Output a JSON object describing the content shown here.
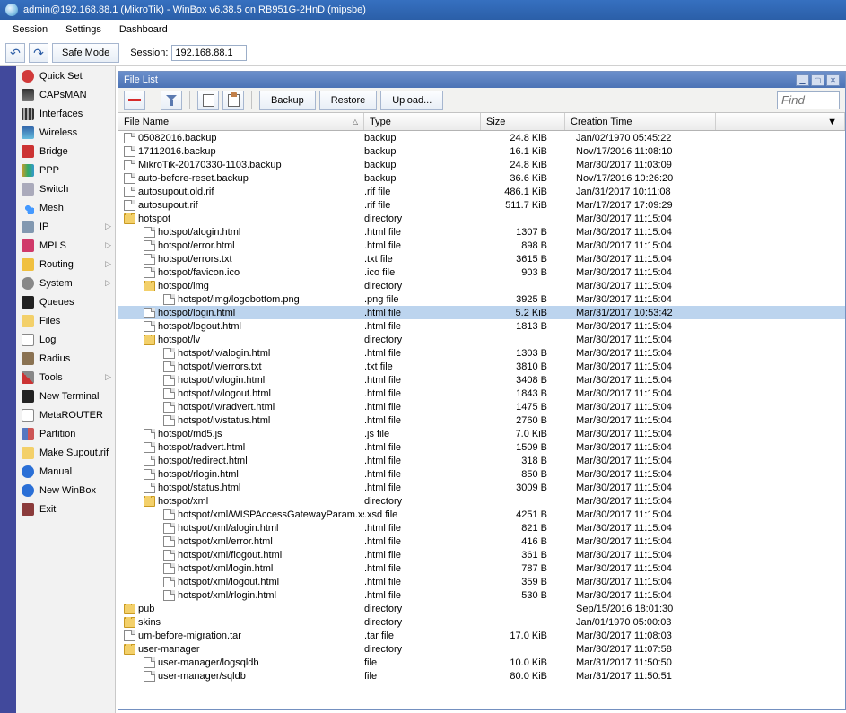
{
  "title": "admin@192.168.88.1 (MikroTik) - WinBox v6.38.5 on RB951G-2HnD (mipsbe)",
  "menubar": {
    "session": "Session",
    "settings": "Settings",
    "dashboard": "Dashboard"
  },
  "toolbar": {
    "safe_mode": "Safe Mode",
    "session_label": "Session:",
    "session_value": "192.168.88.1"
  },
  "sidebar": [
    {
      "label": "Quick Set",
      "ic": "ic-qs",
      "caret": false
    },
    {
      "label": "CAPsMAN",
      "ic": "ic-cap",
      "caret": false
    },
    {
      "label": "Interfaces",
      "ic": "ic-int",
      "caret": false
    },
    {
      "label": "Wireless",
      "ic": "ic-wl",
      "caret": false
    },
    {
      "label": "Bridge",
      "ic": "ic-br",
      "caret": false
    },
    {
      "label": "PPP",
      "ic": "ic-ppp",
      "caret": false
    },
    {
      "label": "Switch",
      "ic": "ic-sw",
      "caret": false
    },
    {
      "label": "Mesh",
      "ic": "ic-mesh",
      "caret": false
    },
    {
      "label": "IP",
      "ic": "ic-ip",
      "caret": true
    },
    {
      "label": "MPLS",
      "ic": "ic-mpls",
      "caret": true
    },
    {
      "label": "Routing",
      "ic": "ic-rt",
      "caret": true
    },
    {
      "label": "System",
      "ic": "ic-sys",
      "caret": true
    },
    {
      "label": "Queues",
      "ic": "ic-q",
      "caret": false
    },
    {
      "label": "Files",
      "ic": "ic-fl",
      "caret": false
    },
    {
      "label": "Log",
      "ic": "ic-log",
      "caret": false
    },
    {
      "label": "Radius",
      "ic": "ic-rad",
      "caret": false
    },
    {
      "label": "Tools",
      "ic": "ic-tool",
      "caret": true
    },
    {
      "label": "New Terminal",
      "ic": "ic-term",
      "caret": false
    },
    {
      "label": "MetaROUTER",
      "ic": "ic-meta",
      "caret": false
    },
    {
      "label": "Partition",
      "ic": "ic-part",
      "caret": false
    },
    {
      "label": "Make Supout.rif",
      "ic": "ic-sup",
      "caret": false
    },
    {
      "label": "Manual",
      "ic": "ic-man",
      "caret": false
    },
    {
      "label": "New WinBox",
      "ic": "ic-nwb",
      "caret": false
    },
    {
      "label": "Exit",
      "ic": "ic-exit",
      "caret": false
    }
  ],
  "filewin": {
    "title": "File List",
    "buttons": {
      "backup": "Backup",
      "restore": "Restore",
      "upload": "Upload..."
    },
    "find_placeholder": "Find",
    "header": {
      "name": "File Name",
      "type": "Type",
      "size": "Size",
      "ctime": "Creation Time"
    },
    "rows": [
      {
        "indent": 0,
        "icon": "file",
        "name": "05082016.backup",
        "type": "backup",
        "size": "24.8 KiB",
        "ctime": "Jan/02/1970 05:45:22"
      },
      {
        "indent": 0,
        "icon": "file",
        "name": "17112016.backup",
        "type": "backup",
        "size": "16.1 KiB",
        "ctime": "Nov/17/2016 11:08:10"
      },
      {
        "indent": 0,
        "icon": "file",
        "name": "MikroTik-20170330-1103.backup",
        "type": "backup",
        "size": "24.8 KiB",
        "ctime": "Mar/30/2017 11:03:09"
      },
      {
        "indent": 0,
        "icon": "file",
        "name": "auto-before-reset.backup",
        "type": "backup",
        "size": "36.6 KiB",
        "ctime": "Nov/17/2016 10:26:20"
      },
      {
        "indent": 0,
        "icon": "file",
        "name": "autosupout.old.rif",
        "type": ".rif file",
        "size": "486.1 KiB",
        "ctime": "Jan/31/2017 10:11:08"
      },
      {
        "indent": 0,
        "icon": "file",
        "name": "autosupout.rif",
        "type": ".rif file",
        "size": "511.7 KiB",
        "ctime": "Mar/17/2017 17:09:29"
      },
      {
        "indent": 0,
        "icon": "folder",
        "name": "hotspot",
        "type": "directory",
        "size": "",
        "ctime": "Mar/30/2017 11:15:04"
      },
      {
        "indent": 1,
        "icon": "file",
        "name": "hotspot/alogin.html",
        "type": ".html file",
        "size": "1307 B",
        "ctime": "Mar/30/2017 11:15:04"
      },
      {
        "indent": 1,
        "icon": "file",
        "name": "hotspot/error.html",
        "type": ".html file",
        "size": "898 B",
        "ctime": "Mar/30/2017 11:15:04"
      },
      {
        "indent": 1,
        "icon": "file",
        "name": "hotspot/errors.txt",
        "type": ".txt file",
        "size": "3615 B",
        "ctime": "Mar/30/2017 11:15:04"
      },
      {
        "indent": 1,
        "icon": "file",
        "name": "hotspot/favicon.ico",
        "type": ".ico file",
        "size": "903 B",
        "ctime": "Mar/30/2017 11:15:04"
      },
      {
        "indent": 1,
        "icon": "folder",
        "name": "hotspot/img",
        "type": "directory",
        "size": "",
        "ctime": "Mar/30/2017 11:15:04"
      },
      {
        "indent": 2,
        "icon": "file",
        "name": "hotspot/img/logobottom.png",
        "type": ".png file",
        "size": "3925 B",
        "ctime": "Mar/30/2017 11:15:04"
      },
      {
        "indent": 1,
        "icon": "file",
        "name": "hotspot/login.html",
        "type": ".html file",
        "size": "5.2 KiB",
        "ctime": "Mar/31/2017 10:53:42",
        "selected": true
      },
      {
        "indent": 1,
        "icon": "file",
        "name": "hotspot/logout.html",
        "type": ".html file",
        "size": "1813 B",
        "ctime": "Mar/30/2017 11:15:04"
      },
      {
        "indent": 1,
        "icon": "folder",
        "name": "hotspot/lv",
        "type": "directory",
        "size": "",
        "ctime": "Mar/30/2017 11:15:04"
      },
      {
        "indent": 2,
        "icon": "file",
        "name": "hotspot/lv/alogin.html",
        "type": ".html file",
        "size": "1303 B",
        "ctime": "Mar/30/2017 11:15:04"
      },
      {
        "indent": 2,
        "icon": "file",
        "name": "hotspot/lv/errors.txt",
        "type": ".txt file",
        "size": "3810 B",
        "ctime": "Mar/30/2017 11:15:04"
      },
      {
        "indent": 2,
        "icon": "file",
        "name": "hotspot/lv/login.html",
        "type": ".html file",
        "size": "3408 B",
        "ctime": "Mar/30/2017 11:15:04"
      },
      {
        "indent": 2,
        "icon": "file",
        "name": "hotspot/lv/logout.html",
        "type": ".html file",
        "size": "1843 B",
        "ctime": "Mar/30/2017 11:15:04"
      },
      {
        "indent": 2,
        "icon": "file",
        "name": "hotspot/lv/radvert.html",
        "type": ".html file",
        "size": "1475 B",
        "ctime": "Mar/30/2017 11:15:04"
      },
      {
        "indent": 2,
        "icon": "file",
        "name": "hotspot/lv/status.html",
        "type": ".html file",
        "size": "2760 B",
        "ctime": "Mar/30/2017 11:15:04"
      },
      {
        "indent": 1,
        "icon": "file",
        "name": "hotspot/md5.js",
        "type": ".js file",
        "size": "7.0 KiB",
        "ctime": "Mar/30/2017 11:15:04"
      },
      {
        "indent": 1,
        "icon": "file",
        "name": "hotspot/radvert.html",
        "type": ".html file",
        "size": "1509 B",
        "ctime": "Mar/30/2017 11:15:04"
      },
      {
        "indent": 1,
        "icon": "file",
        "name": "hotspot/redirect.html",
        "type": ".html file",
        "size": "318 B",
        "ctime": "Mar/30/2017 11:15:04"
      },
      {
        "indent": 1,
        "icon": "file",
        "name": "hotspot/rlogin.html",
        "type": ".html file",
        "size": "850 B",
        "ctime": "Mar/30/2017 11:15:04"
      },
      {
        "indent": 1,
        "icon": "file",
        "name": "hotspot/status.html",
        "type": ".html file",
        "size": "3009 B",
        "ctime": "Mar/30/2017 11:15:04"
      },
      {
        "indent": 1,
        "icon": "folder",
        "name": "hotspot/xml",
        "type": "directory",
        "size": "",
        "ctime": "Mar/30/2017 11:15:04"
      },
      {
        "indent": 2,
        "icon": "file",
        "name": "hotspot/xml/WISPAccessGatewayParam.xsd",
        "type": ".xsd file",
        "size": "4251 B",
        "ctime": "Mar/30/2017 11:15:04"
      },
      {
        "indent": 2,
        "icon": "file",
        "name": "hotspot/xml/alogin.html",
        "type": ".html file",
        "size": "821 B",
        "ctime": "Mar/30/2017 11:15:04"
      },
      {
        "indent": 2,
        "icon": "file",
        "name": "hotspot/xml/error.html",
        "type": ".html file",
        "size": "416 B",
        "ctime": "Mar/30/2017 11:15:04"
      },
      {
        "indent": 2,
        "icon": "file",
        "name": "hotspot/xml/flogout.html",
        "type": ".html file",
        "size": "361 B",
        "ctime": "Mar/30/2017 11:15:04"
      },
      {
        "indent": 2,
        "icon": "file",
        "name": "hotspot/xml/login.html",
        "type": ".html file",
        "size": "787 B",
        "ctime": "Mar/30/2017 11:15:04"
      },
      {
        "indent": 2,
        "icon": "file",
        "name": "hotspot/xml/logout.html",
        "type": ".html file",
        "size": "359 B",
        "ctime": "Mar/30/2017 11:15:04"
      },
      {
        "indent": 2,
        "icon": "file",
        "name": "hotspot/xml/rlogin.html",
        "type": ".html file",
        "size": "530 B",
        "ctime": "Mar/30/2017 11:15:04"
      },
      {
        "indent": 0,
        "icon": "folder",
        "name": "pub",
        "type": "directory",
        "size": "",
        "ctime": "Sep/15/2016 18:01:30"
      },
      {
        "indent": 0,
        "icon": "folder",
        "name": "skins",
        "type": "directory",
        "size": "",
        "ctime": "Jan/01/1970 05:00:03"
      },
      {
        "indent": 0,
        "icon": "file",
        "name": "um-before-migration.tar",
        "type": ".tar file",
        "size": "17.0 KiB",
        "ctime": "Mar/30/2017 11:08:03"
      },
      {
        "indent": 0,
        "icon": "folder",
        "name": "user-manager",
        "type": "directory",
        "size": "",
        "ctime": "Mar/30/2017 11:07:58"
      },
      {
        "indent": 1,
        "icon": "file",
        "name": "user-manager/logsqldb",
        "type": "file",
        "size": "10.0 KiB",
        "ctime": "Mar/31/2017 11:50:50"
      },
      {
        "indent": 1,
        "icon": "file",
        "name": "user-manager/sqldb",
        "type": "file",
        "size": "80.0 KiB",
        "ctime": "Mar/31/2017 11:50:51"
      }
    ]
  }
}
